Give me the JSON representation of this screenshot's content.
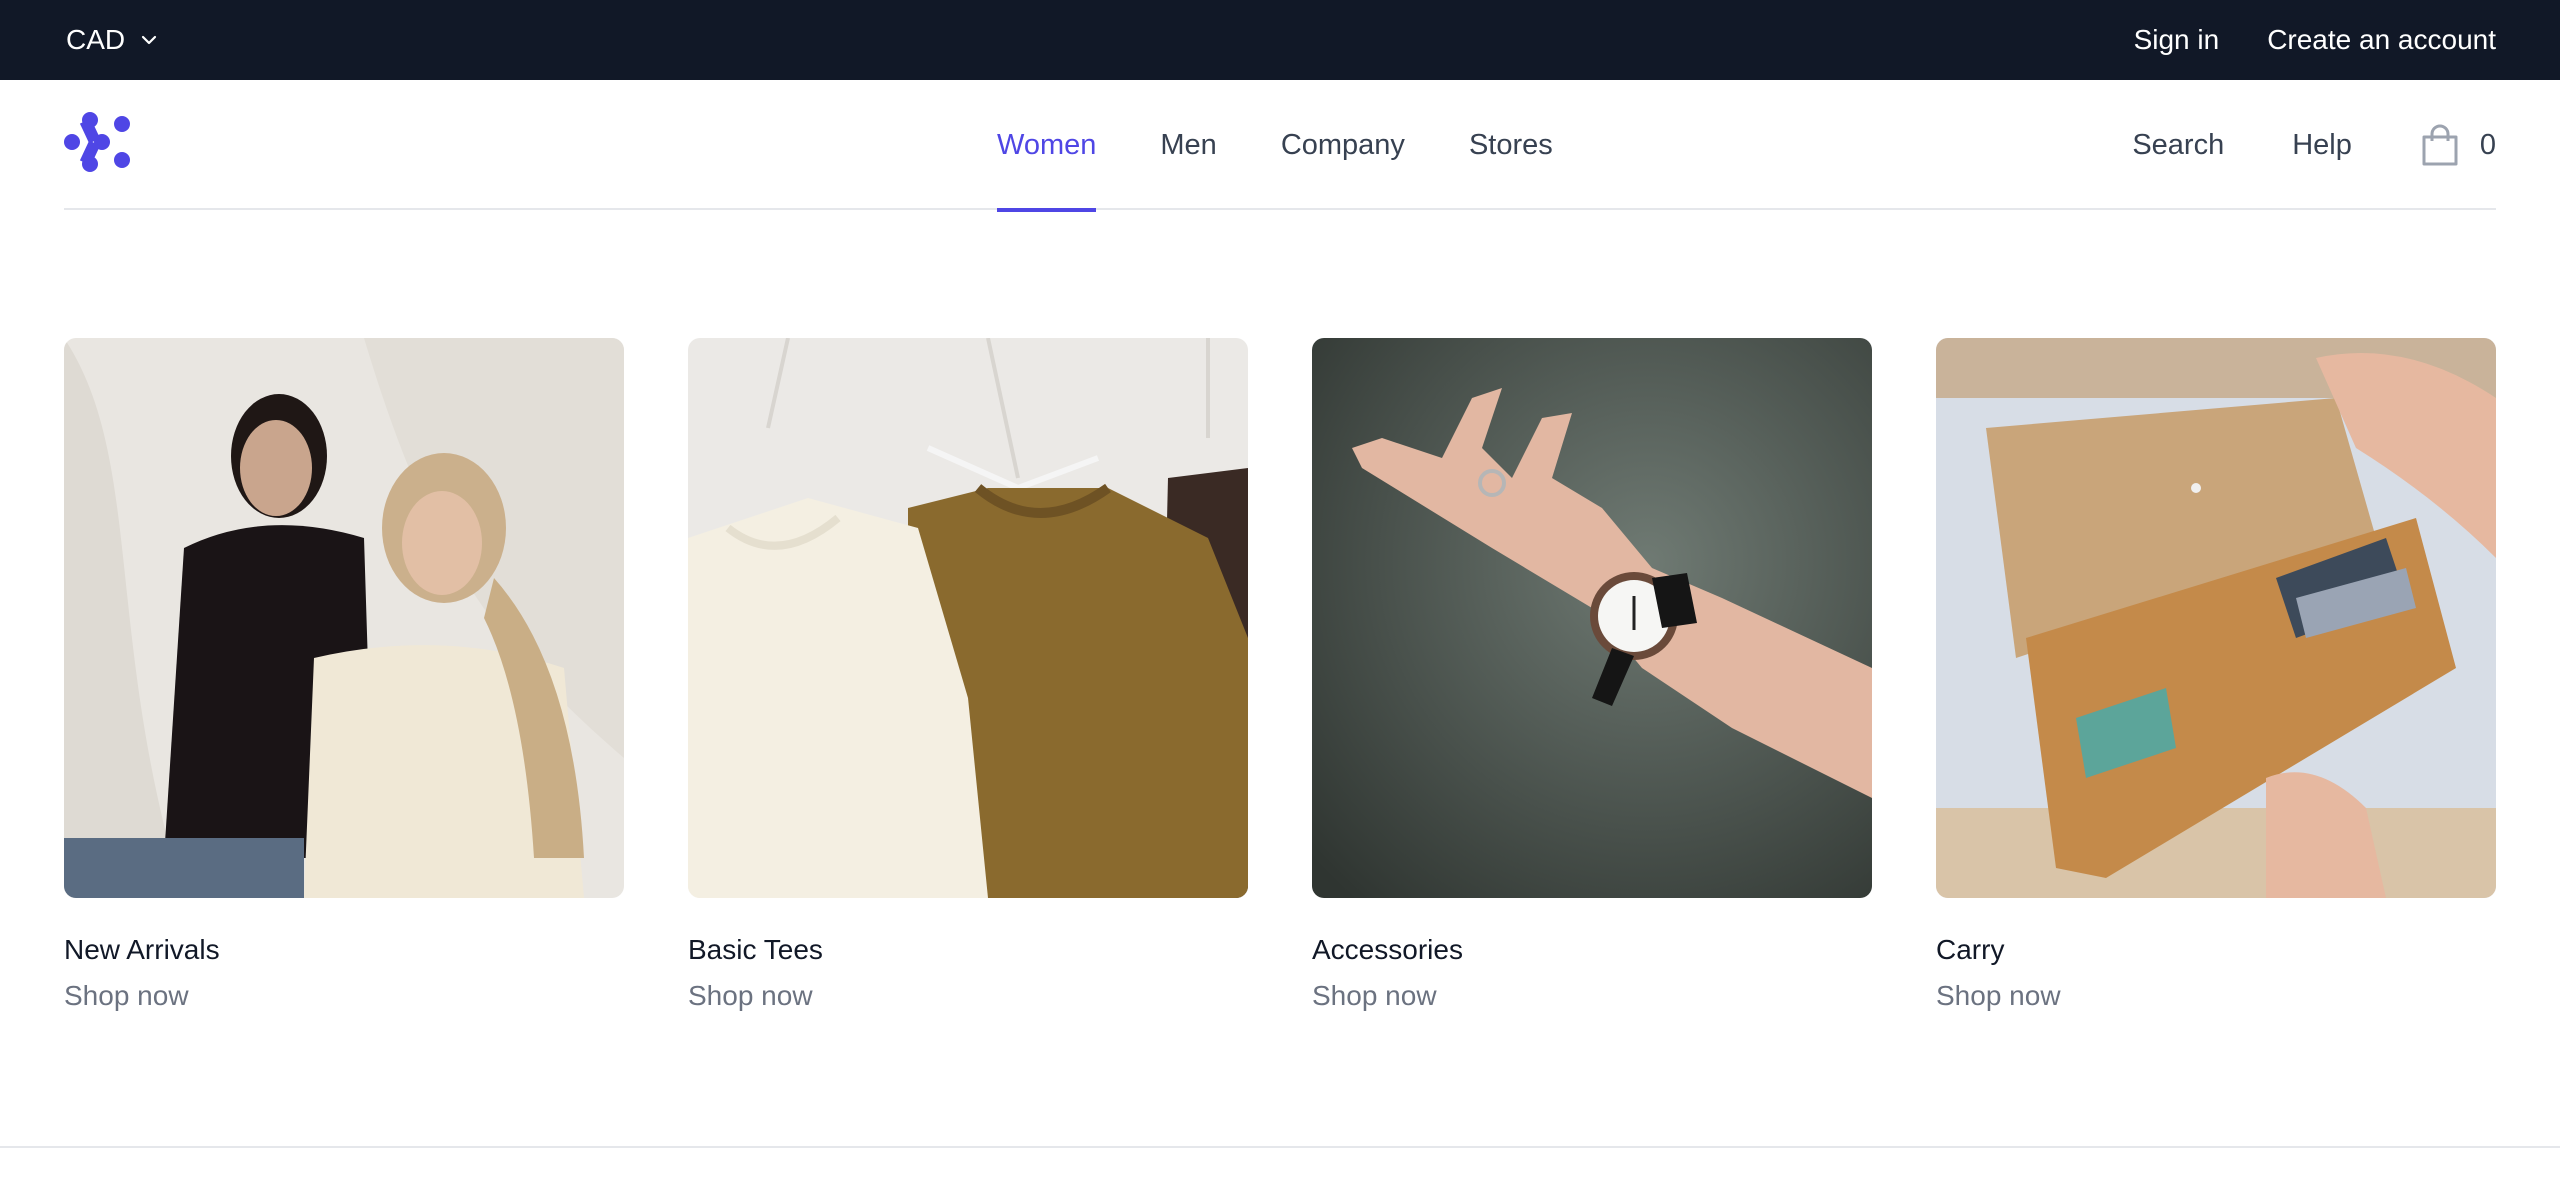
{
  "topbar": {
    "currency": "CAD",
    "sign_in": "Sign in",
    "create_account": "Create an account"
  },
  "nav": {
    "items": [
      {
        "label": "Women",
        "active": true
      },
      {
        "label": "Men",
        "active": false
      },
      {
        "label": "Company",
        "active": false
      },
      {
        "label": "Stores",
        "active": false
      }
    ],
    "search": "Search",
    "help": "Help",
    "cart_count": "0"
  },
  "categories": [
    {
      "title": "New Arrivals",
      "link": "Shop now"
    },
    {
      "title": "Basic Tees",
      "link": "Shop now"
    },
    {
      "title": "Accessories",
      "link": "Shop now"
    },
    {
      "title": "Carry",
      "link": "Shop now"
    }
  ],
  "colors": {
    "topbar_bg": "#111827",
    "accent": "#4f46e5",
    "muted_text": "#6b7280"
  },
  "icons": {
    "currency_toggle": "chevron-down-icon",
    "logo": "brand-logo-icon",
    "cart": "shopping-bag-icon"
  }
}
